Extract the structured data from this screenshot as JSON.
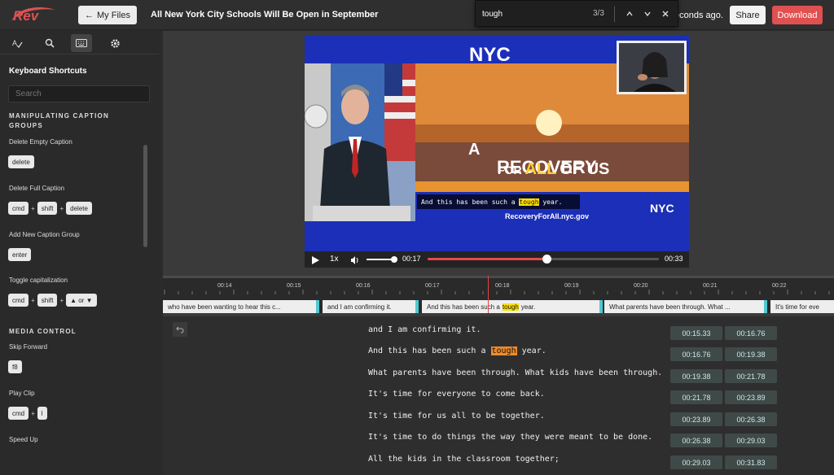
{
  "app": {
    "logo": "Rev",
    "my_files": "My Files",
    "title": "All New York City Schools Will Be Open in September",
    "saved_status": "econds ago.",
    "share": "Share",
    "download": "Download"
  },
  "find": {
    "query": "tough",
    "count": "3/3"
  },
  "sidebar": {
    "heading": "Keyboard Shortcuts",
    "search_placeholder": "Search",
    "section1": "MANIPULATING CAPTION GROUPS",
    "items": [
      {
        "label": "Delete Empty Caption",
        "keys": [
          "delete"
        ]
      },
      {
        "label": "Delete Full Caption",
        "keys": [
          "cmd",
          "shift",
          "delete"
        ]
      },
      {
        "label": "Add New Caption Group",
        "keys": [
          "enter"
        ]
      },
      {
        "label": "Toggle capitalization",
        "keys": [
          "cmd",
          "shift",
          "▲ or ▼"
        ]
      }
    ],
    "section2": "MEDIA CONTROL",
    "media_items": [
      {
        "label": "Skip Forward",
        "keys": [
          "f8"
        ]
      },
      {
        "label": "Play Clip",
        "keys": [
          "cmd",
          "l"
        ]
      },
      {
        "label": "Speed Up",
        "keys": []
      }
    ]
  },
  "video": {
    "nyc": "NYC",
    "slide_a": "A",
    "slide_recovery": "RECOVERY",
    "slide_for": "FOR",
    "slide_all": "ALL",
    "slide_ofus": "OF US",
    "slide_url": "RecoveryForAll.nyc.gov",
    "nyc_small": "NYC",
    "caption_before": "And this has been such a ",
    "caption_hl": "tough",
    "caption_after": " year.",
    "speed": "1x",
    "current_time": "00:17",
    "duration": "00:33",
    "progress": 0.515
  },
  "timeline": {
    "ticks": [
      "00:14",
      "00:15",
      "00:16",
      "00:17",
      "00:18",
      "00:19",
      "00:20",
      "00:21",
      "00:22"
    ],
    "captions": [
      {
        "text": "who have been wanting to hear this c..."
      },
      {
        "text": "and I am confirming it."
      },
      {
        "text": "And this has been such a tough year."
      },
      {
        "text": "What parents have been through. What ..."
      },
      {
        "text": "It's time for eve"
      }
    ]
  },
  "transcript": {
    "lines": [
      {
        "before": "and I am confirming it.",
        "hl": "",
        "after": "",
        "start": "00:15.33",
        "end": "00:16.76"
      },
      {
        "before": "And this has been such a ",
        "hl": "tough",
        "after": " year.",
        "start": "00:16.76",
        "end": "00:19.38"
      },
      {
        "before": "What parents have been through. What kids have been through.",
        "hl": "",
        "after": "",
        "start": "00:19.38",
        "end": "00:21.78"
      },
      {
        "before": "It's time for everyone to come back.",
        "hl": "",
        "after": "",
        "start": "00:21.78",
        "end": "00:23.89"
      },
      {
        "before": "It's time for us all to be together.",
        "hl": "",
        "after": "",
        "start": "00:23.89",
        "end": "00:26.38"
      },
      {
        "before": "It's time to do things the way they were meant to be done.",
        "hl": "",
        "after": "",
        "start": "00:26.38",
        "end": "00:29.03"
      },
      {
        "before": "All the kids in the classroom together;",
        "hl": "",
        "after": "",
        "start": "00:29.03",
        "end": "00:31.83"
      }
    ]
  },
  "colors": {
    "accent_red": "#e05050",
    "caption_handle": "#4fc9cf",
    "search_highlight": "#f08a2c",
    "video_highlight": "#ffe000"
  }
}
